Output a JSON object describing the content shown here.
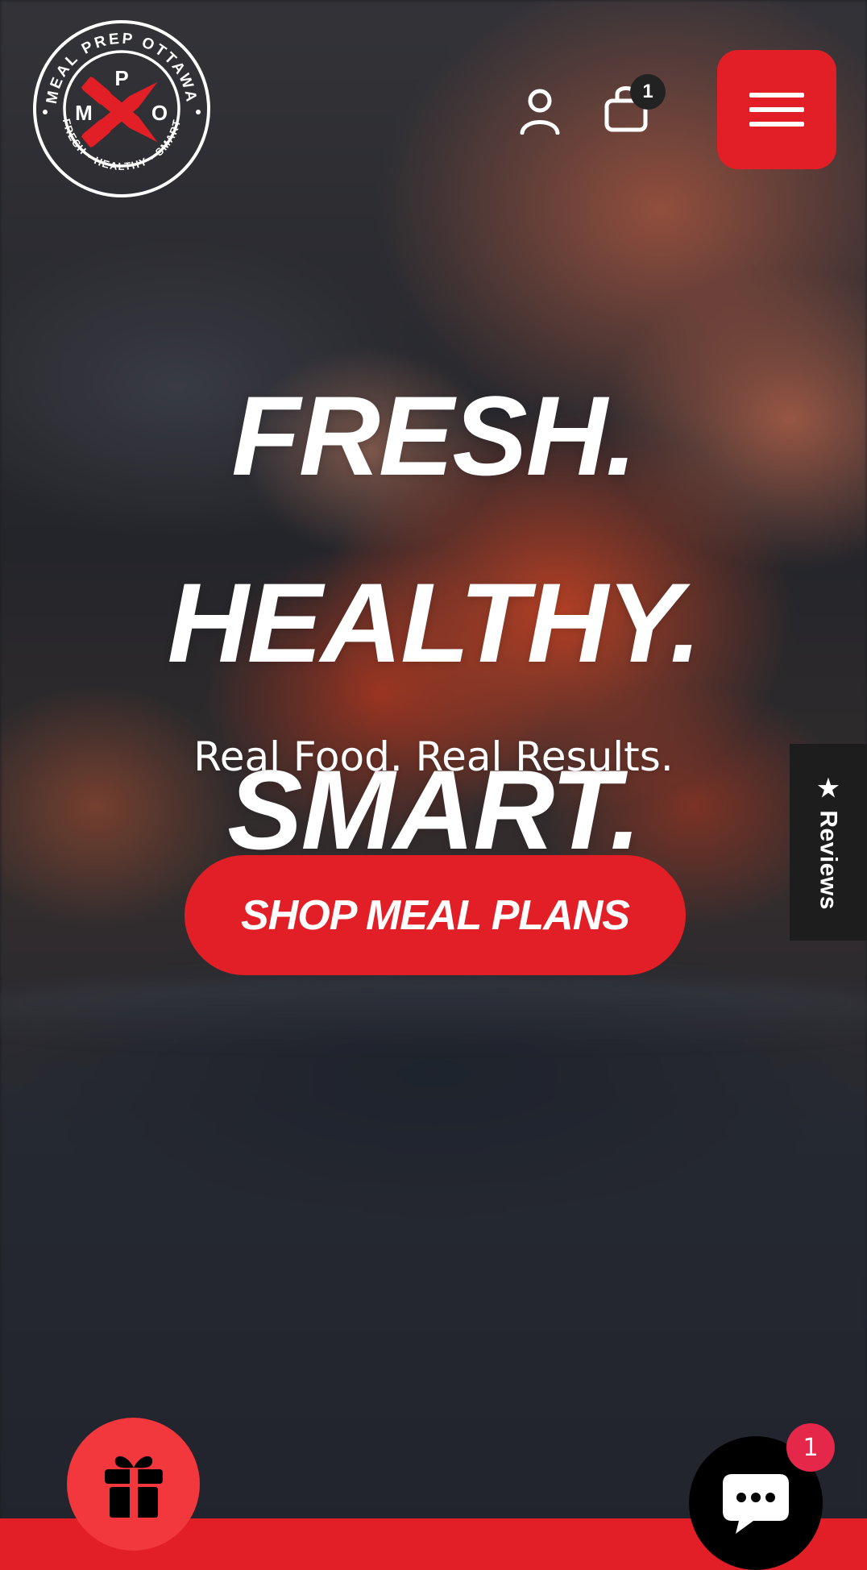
{
  "header": {
    "logo": {
      "text_top": "MEAL PREP OTTAWA",
      "text_bottom": "FRESH • HEALTHY • SMART",
      "letters": [
        "M",
        "P",
        "O"
      ]
    },
    "account_icon": "user-icon",
    "cart": {
      "icon": "shopping-bag-icon",
      "count": "1"
    },
    "menu_icon": "hamburger-menu-icon"
  },
  "hero": {
    "title_line1": "FRESH. HEALTHY.",
    "title_line2": "SMART.",
    "subtitle": "Real Food. Real Results.",
    "cta_label": "SHOP MEAL PLANS"
  },
  "reviews_tab": {
    "label": "★ Reviews"
  },
  "floating": {
    "gift_icon": "gift-icon",
    "chat_icon": "chat-bubble-icon",
    "chat_badge": "1"
  },
  "colors": {
    "brand_red": "#e21f26",
    "gift_red": "#f2383c",
    "badge_pink": "#e5284a",
    "reviews_bg": "#1d1d1d",
    "white": "#ffffff"
  }
}
